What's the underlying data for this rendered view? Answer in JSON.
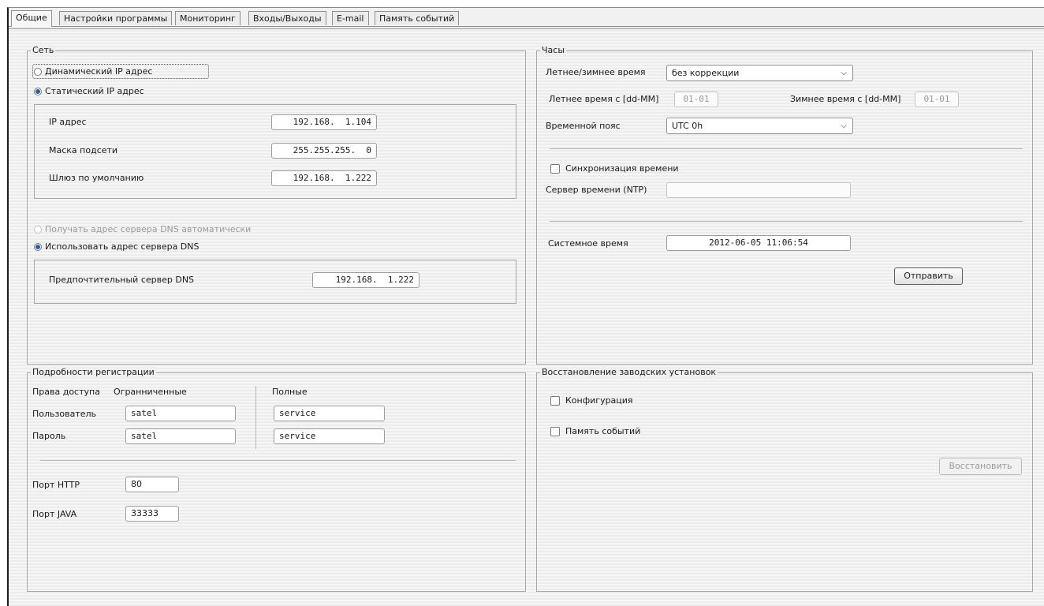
{
  "tabs": [
    "Общие",
    "Настройки программы",
    "Мониторинг",
    "Входы/Выходы",
    "E-mail",
    "Память событий"
  ],
  "network": {
    "title": "Сеть",
    "dynamic_ip": "Динамический IP адрес",
    "static_ip": "Статический IP адрес",
    "ip_label": "IP адрес",
    "ip_value": "192.168.  1.104",
    "mask_label": "Маска подсети",
    "mask_value": "255.255.255.  0",
    "gateway_label": "Шлюз по умолчанию",
    "gateway_value": "192.168.  1.222",
    "dns_auto": "Получать адрес сервера DNS автоматически",
    "dns_manual": "Использовать адрес сервера DNS",
    "dns_pref_label": "Предпочтительный сервер DNS",
    "dns_pref_value": "192.168.  1.222"
  },
  "clock": {
    "title": "Часы",
    "dst_label": "Летнее/зимнее время",
    "dst_value": "без коррекции",
    "summer_label": "Летнее время с [dd-MM]",
    "summer_value": "01-01",
    "winter_label": "Зимнее время с [dd-MM]",
    "winter_value": "01-01",
    "tz_label": "Временной пояс",
    "tz_value": "UTC 0h",
    "sync_label": "Синхронизация времени",
    "ntp_label": "Сервер времени (NTP)",
    "ntp_value": "",
    "systime_label": "Системное время",
    "systime_value": "2012-06-05 11:06:54",
    "send_button": "Отправить"
  },
  "login": {
    "title": "Подробности регистрации",
    "access_label": "Права доступа",
    "limited_label": "Огранниченные",
    "full_label": "Полные",
    "user_label": "Пользователь",
    "user_limited": "satel",
    "user_full": "service",
    "pass_label": "Пароль",
    "pass_limited": "satel",
    "pass_full": "service",
    "http_label": "Порт HTTP",
    "http_value": "80",
    "java_label": "Порт JAVA",
    "java_value": "33333"
  },
  "restore": {
    "title": "Восстановление заводских установок",
    "config_label": "Конфигурация",
    "events_label": "Память событий",
    "restore_button": "Восстановить"
  }
}
